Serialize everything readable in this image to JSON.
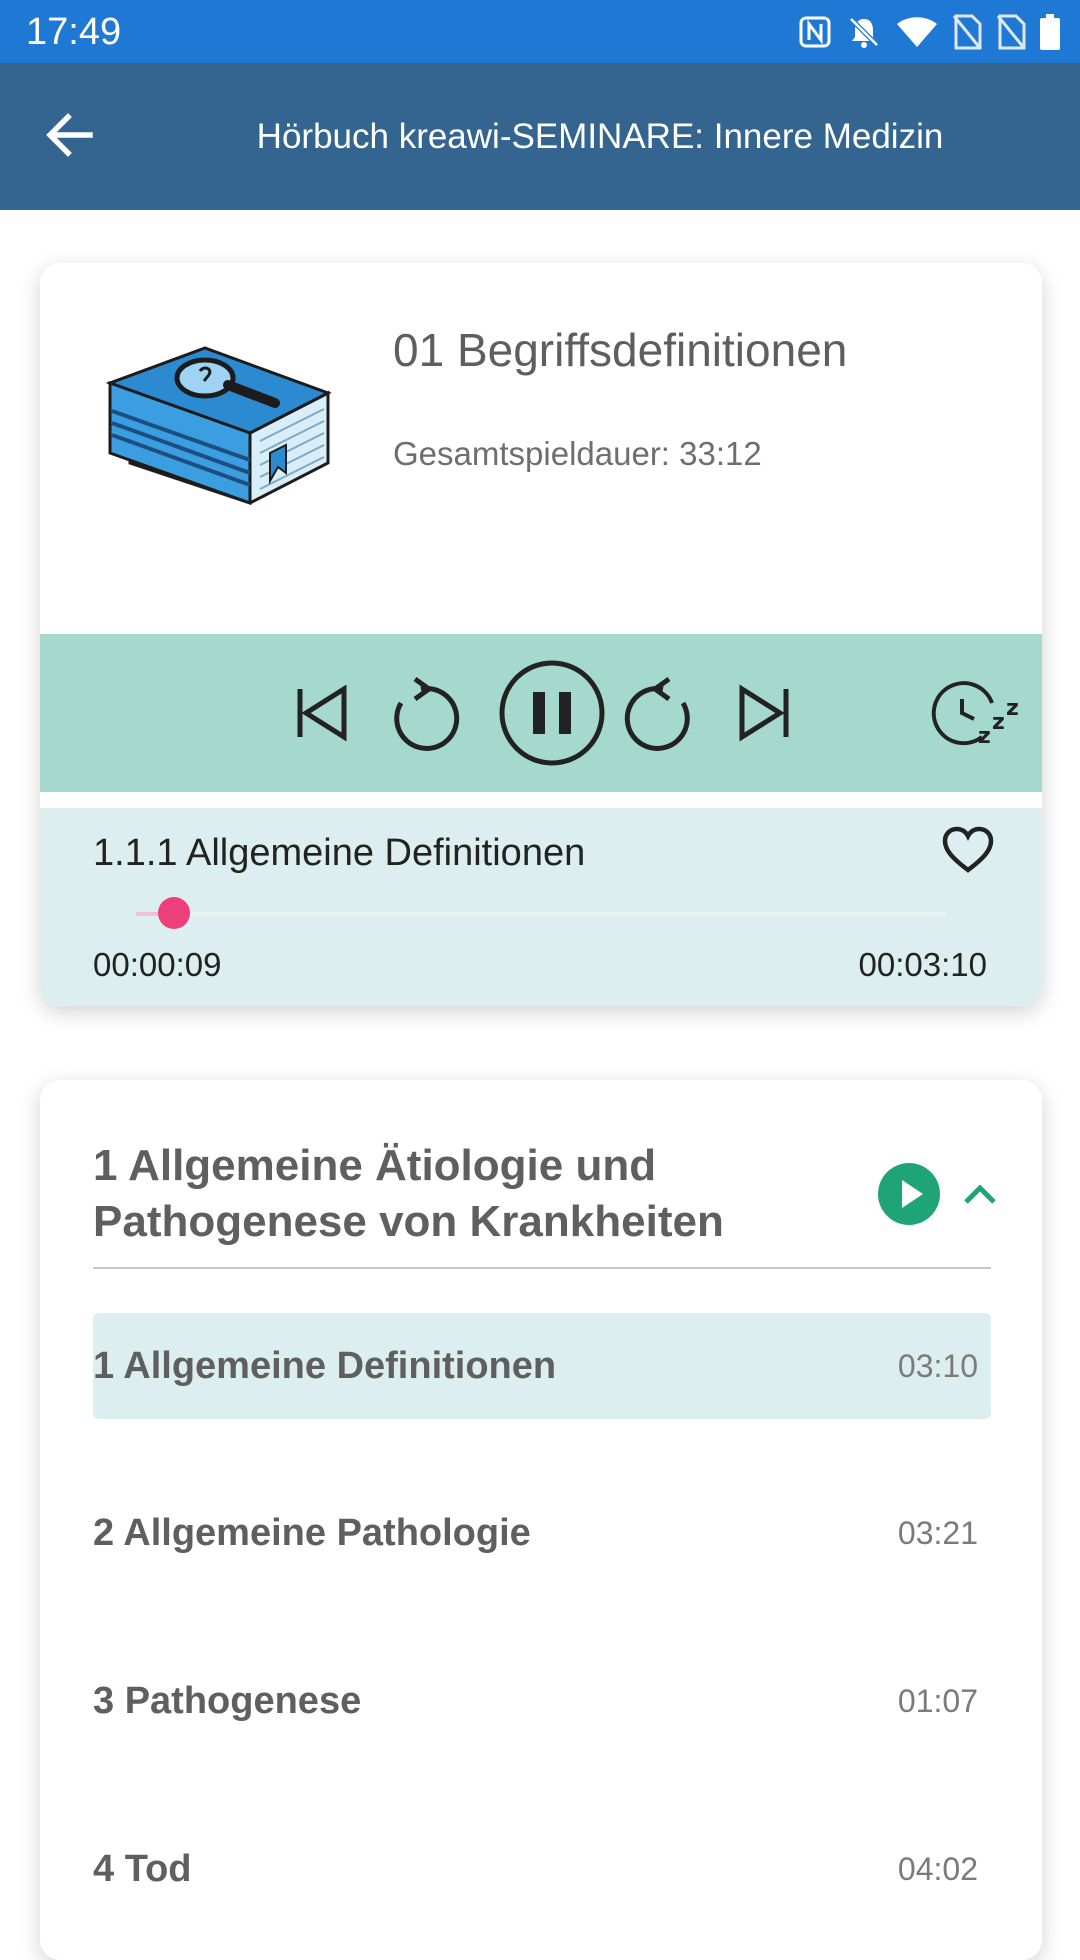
{
  "status_bar": {
    "time": "17:49",
    "icons": [
      "nfc-icon",
      "bell-off-icon",
      "wifi-icon",
      "no-sim-icon",
      "no-sim-icon",
      "battery-icon"
    ],
    "color": "#1f78d3"
  },
  "app_bar": {
    "title": "Hörbuch kreawi-SEMINARE: Innere Medizin",
    "back_icon": "arrow-left-icon",
    "color": "#346591"
  },
  "player": {
    "cover_icon": "book-magnifier-icon",
    "track_title": "01 Begriffsdefinitionen",
    "total_duration": "Gesamtspieldauer: 33:12",
    "controls_color": "#a6d9cd",
    "controls": [
      "skip-previous-icon",
      "replay-icon",
      "pause-icon",
      "forward-icon",
      "skip-next-icon",
      "sleep-timer-icon"
    ],
    "chapter": {
      "title": "1.1.1 Allgemeine Definitionen",
      "favorite_icon": "heart-outline-icon",
      "current_time": "00:00:09",
      "total_time": "00:03:10",
      "progress": 0.047,
      "accent": "#ee3f7a"
    }
  },
  "section": {
    "title": "1 Allgemeine Ätiologie und Pathogenese von Krankheiten",
    "play_icon": "play-circle-icon",
    "collapse_icon": "chevron-up-icon",
    "accent": "#1fa478",
    "tracks": [
      {
        "title": "1 Allgemeine Definitionen",
        "duration": "03:10",
        "active": true
      },
      {
        "title": "2 Allgemeine Pathologie",
        "duration": "03:21",
        "active": false
      },
      {
        "title": "3 Pathogenese",
        "duration": "01:07",
        "active": false
      },
      {
        "title": "4 Tod",
        "duration": "04:02",
        "active": false
      }
    ]
  }
}
